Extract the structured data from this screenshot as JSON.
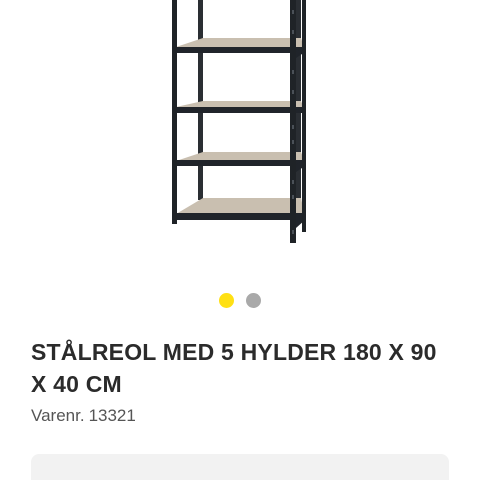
{
  "product": {
    "title": "STÅLREOL MED 5 HYLDER 180 X 90 X 40 CM",
    "sku_label": "Varenr.",
    "sku_value": "13321",
    "image_icon": "steel-shelving-unit-image"
  },
  "carousel": {
    "slide_count": 2,
    "active_index": 0
  },
  "colors": {
    "background": "#ffffff",
    "title_text": "#2b2b2b",
    "sku_text": "#555555",
    "dot_active": "#ffe014",
    "dot_inactive": "#a9a9a9",
    "buy_box_bg": "#f2f2f2",
    "frame": "#1f2327",
    "shelf_board": "#c9bfb0",
    "shelf_edge": "#20242a"
  }
}
